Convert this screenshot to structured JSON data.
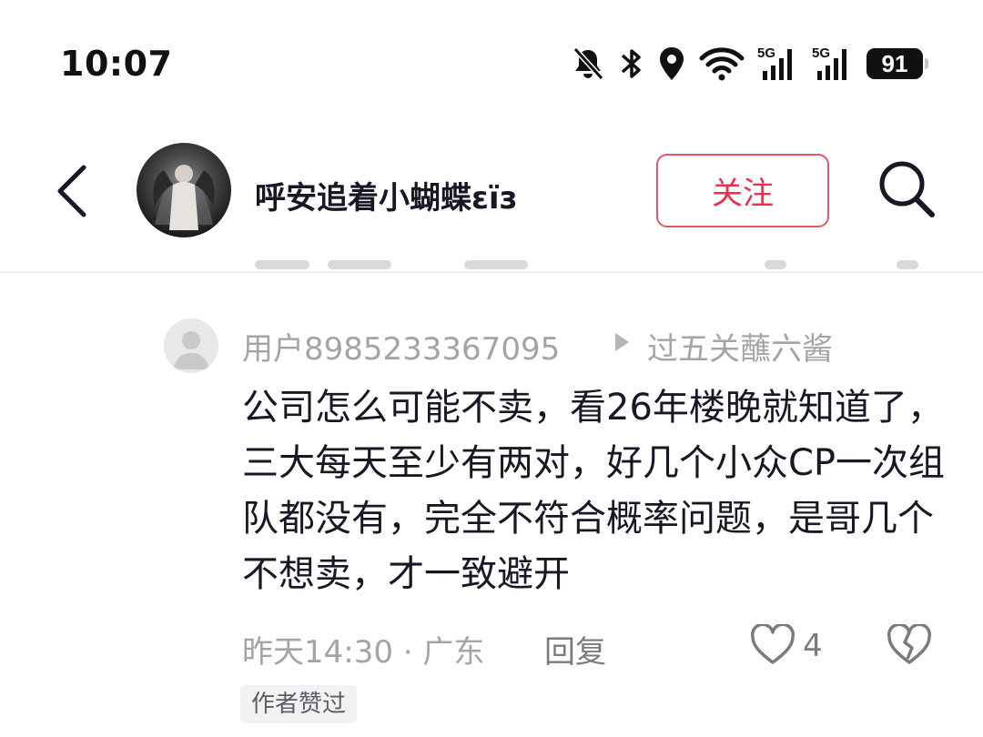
{
  "status_bar": {
    "time": "10:07",
    "network_1": "5G",
    "network_2": "5G",
    "battery": "91"
  },
  "header": {
    "username": "呼安追着小蝴蝶εïз",
    "follow_label": "关注"
  },
  "comment": {
    "user": "用户8985233367095",
    "reply_to": "过五关蘸六酱",
    "text": "公司怎么可能不卖，看26年楼晚就知道了，三大每天至少有两对，好几个小众CP一次组队都没有，完全不符合概率问题，是哥几个不想卖，才一致避开",
    "meta": "昨天14:30 · 广东",
    "reply_label": "回复",
    "like_count": "4",
    "badge": "作者赞过"
  },
  "colors": {
    "accent": "#e8304f",
    "text_primary": "#161823",
    "text_secondary": "#a3a4a8"
  }
}
